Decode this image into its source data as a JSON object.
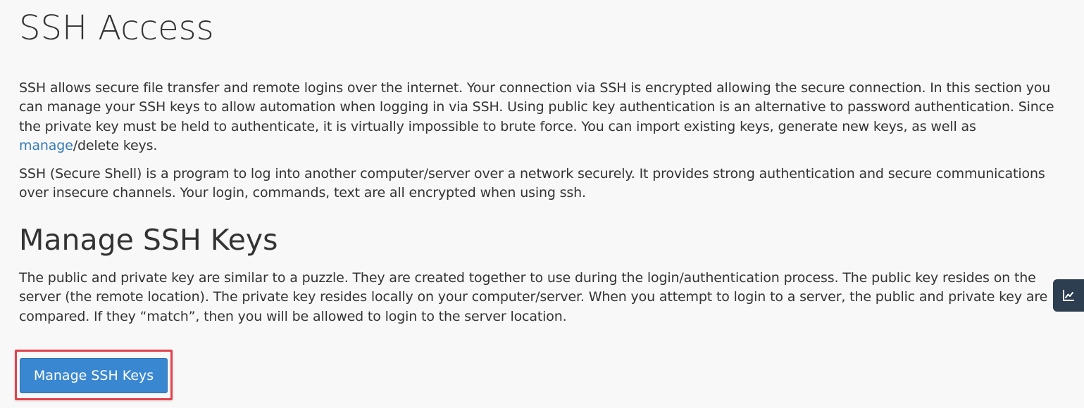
{
  "page": {
    "title": "SSH Access",
    "intro": {
      "before_link": "SSH allows secure file transfer and remote logins over the internet. Your connection via SSH is encrypted allowing the secure connection. In this section you can manage your SSH keys to allow automation when logging in via SSH. Using public key authentication is an alternative to password authentication. Since the private key must be held to authenticate, it is virtually impossible to brute force. You can import existing keys, generate new keys, as well as ",
      "link_text": "manage",
      "after_link": "/delete keys."
    },
    "description": "SSH (Secure Shell) is a program to log into another computer/server over a network securely. It provides strong authentication and secure communications over insecure channels. Your login, commands, text are all encrypted when using ssh."
  },
  "manage_section": {
    "title": "Manage SSH Keys",
    "description": "The public and private key are similar to a puzzle. They are created together to use during the login/authentication process. The public key resides on the server (the remote location). The private key resides locally on your computer/server. When you attempt to login to a server, the public and private key are compared. If they “match”, then you will be allowed to login to the server location.",
    "button_label": "Manage SSH Keys"
  },
  "side_tab": {
    "icon": "line-chart-icon"
  },
  "colors": {
    "button": "#3a87d1",
    "link": "#337ab7",
    "highlight": "#e2424b",
    "side_tab": "#2c3e50"
  }
}
